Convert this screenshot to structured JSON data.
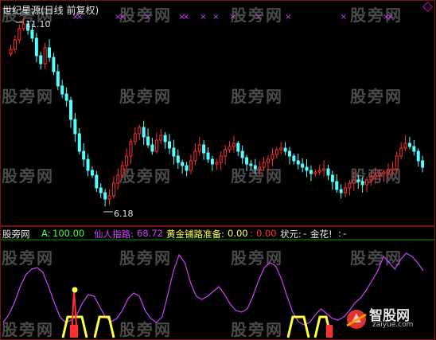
{
  "title": "世纪星源(日线 前复权)",
  "watermark_text": "股旁网",
  "price_high_label": "11.10",
  "price_low_label": "6.18",
  "indicator_bar": {
    "name": "股旁网",
    "a_label": "A:",
    "a_value": "100.00",
    "xianren_label": "仙人指路:",
    "xianren_value": "68.72",
    "huangjin_label": "黄金铺路准备:",
    "huangjin_value": "0.00",
    "extra_value": "0.00",
    "status_label": "状元:",
    "status_value": "-",
    "jinhua_label": "金花!",
    "jinhua_value": "-"
  },
  "logo": {
    "cn": "智股网",
    "url": "zaiyue.com"
  },
  "colors": {
    "up": "#ff3030",
    "down": "#54ffff",
    "frame": "#7a1010",
    "magenta": "#d040ff",
    "yellow": "#ffff40",
    "grid_line": "#00a000"
  },
  "top_markers": [
    0.16,
    0.17,
    0.26,
    0.27,
    0.33,
    0.41,
    0.42,
    0.46,
    0.49,
    0.53,
    0.59,
    0.66,
    0.79,
    0.89,
    0.9
  ]
}
